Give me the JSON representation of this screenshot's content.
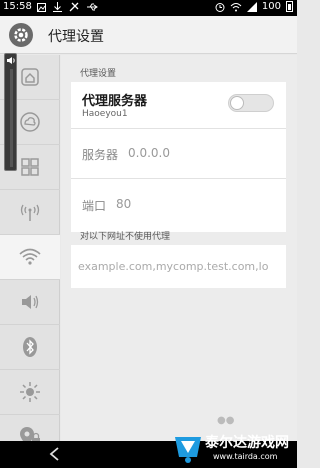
{
  "status_bar": {
    "time": "15:58",
    "battery": "100"
  },
  "header": {
    "title": "代理设置"
  },
  "sidebar": {
    "items": [
      {
        "icon": "home-icon"
      },
      {
        "icon": "cloud-icon"
      },
      {
        "icon": "grid-icon"
      },
      {
        "icon": "antenna-icon"
      },
      {
        "icon": "wifi-icon",
        "active": true
      },
      {
        "icon": "speaker-icon"
      },
      {
        "icon": "bluetooth-icon"
      },
      {
        "icon": "brightness-icon"
      },
      {
        "icon": "location-lock-icon"
      }
    ]
  },
  "main": {
    "section1_label": "代理设置",
    "proxy": {
      "title": "代理服务器",
      "subtitle": "Haoeyou1",
      "enabled": false
    },
    "server": {
      "label": "服务器",
      "value": "0.0.0.0"
    },
    "port": {
      "label": "端口",
      "value": "80"
    },
    "section2_label": "对以下网址不使用代理",
    "exclude": {
      "placeholder": "example.com,mycomp.test.com,lo"
    }
  },
  "watermark": {
    "line1": "泰尔达游戏网",
    "line2": "www.tairda.com"
  }
}
